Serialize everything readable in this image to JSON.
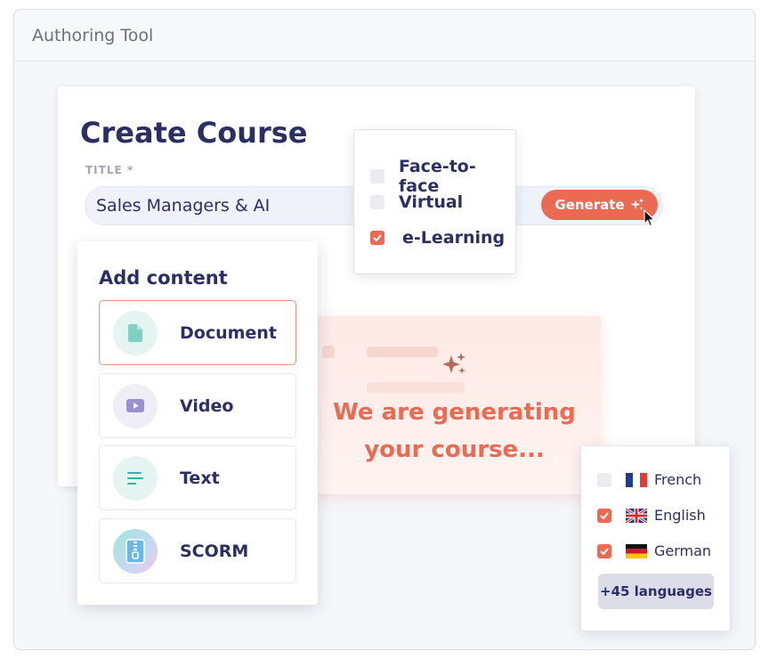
{
  "window": {
    "title": "Authoring Tool"
  },
  "course": {
    "heading": "Create Course",
    "title_label": "TITLE *",
    "title_value": "Sales Managers & AI",
    "generate_label": "Generate"
  },
  "delivery": {
    "options": [
      {
        "label": "Face-to-face",
        "checked": false
      },
      {
        "label": "Virtual",
        "checked": false
      },
      {
        "label": "e-Learning",
        "checked": true
      }
    ]
  },
  "content_panel": {
    "title": "Add content",
    "items": [
      {
        "label": "Document",
        "icon": "document-icon",
        "selected": true
      },
      {
        "label": "Video",
        "icon": "video-icon",
        "selected": false
      },
      {
        "label": "Text",
        "icon": "text-lines-icon",
        "selected": false
      },
      {
        "label": "SCORM",
        "icon": "zip-file-icon",
        "selected": false
      }
    ]
  },
  "generating": {
    "message": "We are generating your course..."
  },
  "languages": {
    "items": [
      {
        "label": "French",
        "checked": false,
        "flag": "france-flag-icon"
      },
      {
        "label": "English",
        "checked": true,
        "flag": "uk-flag-icon"
      },
      {
        "label": "German",
        "checked": true,
        "flag": "germany-flag-icon"
      }
    ],
    "more_label": "+45 languages"
  },
  "colors": {
    "accent": "#ec6a52",
    "text_primary": "#2c2f66",
    "label_muted": "#a3a6b8",
    "window_bg": "#f6f7fb"
  }
}
